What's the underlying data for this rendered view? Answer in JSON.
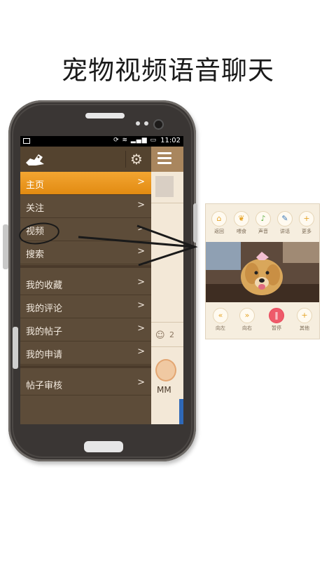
{
  "headline": "宠物视频语音聊天",
  "status_bar": {
    "time": "11:02",
    "icons": "⟳ ≋ ▂▄▆ ▭"
  },
  "menu": {
    "items": [
      {
        "label": "主页",
        "arrow": ">"
      },
      {
        "label": "关注",
        "arrow": ">"
      },
      {
        "label": "视频",
        "arrow": ">"
      },
      {
        "label": "搜索",
        "arrow": ">"
      },
      {
        "label": "我的收藏",
        "arrow": ">"
      },
      {
        "label": "我的评论",
        "arrow": ">"
      },
      {
        "label": "我的帖子",
        "arrow": ">"
      },
      {
        "label": "我的申请",
        "arrow": ">"
      },
      {
        "label": "帖子审核",
        "arrow": ">"
      }
    ],
    "gear_icon": "gear-icon",
    "active_color": "#f0a02a"
  },
  "peek": {
    "comment_count": "2",
    "username": "MM"
  },
  "panel": {
    "top_buttons": [
      {
        "icon": "home-icon",
        "caption": "返回"
      },
      {
        "icon": "food-icon",
        "caption": "喂食"
      },
      {
        "icon": "mic-icon",
        "caption": "声音"
      },
      {
        "icon": "telescope-icon",
        "caption": "讲话"
      },
      {
        "icon": "plus-icon",
        "caption": "更多"
      }
    ],
    "bottom_buttons": [
      {
        "icon": "rewind-icon",
        "caption": "向左"
      },
      {
        "icon": "forward-icon",
        "caption": "向右"
      },
      {
        "icon": "pause-icon",
        "caption": "暂停"
      },
      {
        "icon": "plus-icon",
        "caption": "其他"
      }
    ]
  }
}
